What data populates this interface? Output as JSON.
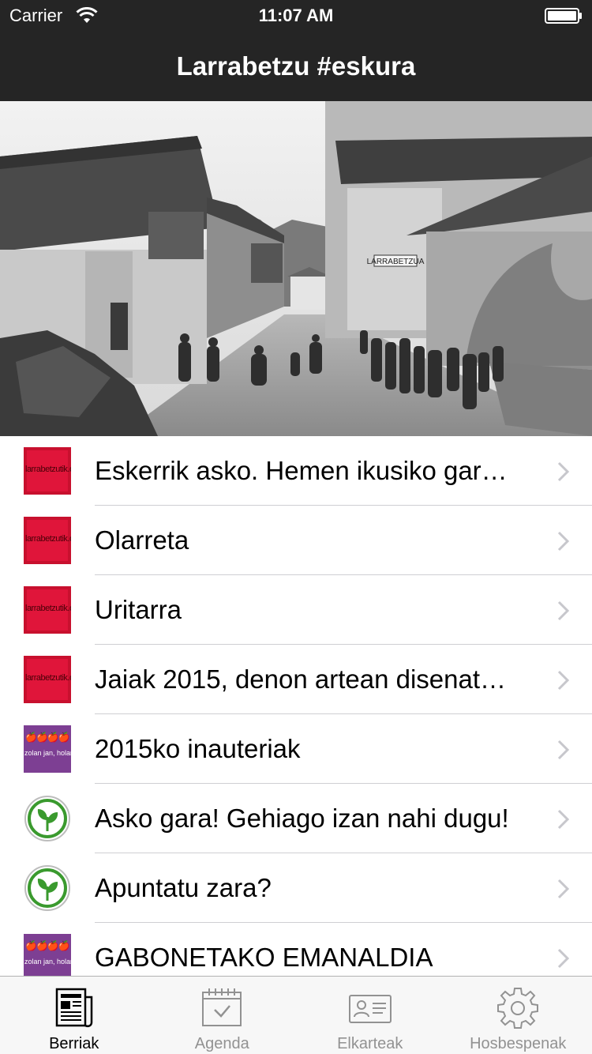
{
  "status_bar": {
    "carrier": "Carrier",
    "time": "11:07 AM",
    "wifi_icon": "wifi-icon",
    "battery_icon": "battery-icon"
  },
  "nav": {
    "title": "Larrabetzu #eskura"
  },
  "hero": {
    "sign_text": "LARRABETZUA"
  },
  "news": [
    {
      "title": "Eskerrik asko. Hemen ikusiko gar…",
      "thumb": "larrabetzutik-logo",
      "thumb_text": "larrabetzutik.org"
    },
    {
      "title": "Olarreta",
      "thumb": "larrabetzutik-logo",
      "thumb_text": "larrabetzutik.org"
    },
    {
      "title": "Uritarra",
      "thumb": "larrabetzutik-logo",
      "thumb_text": "larrabetzutik.org"
    },
    {
      "title": "Jaiak 2015, denon artean disenat…",
      "thumb": "larrabetzutik-logo",
      "thumb_text": "larrabetzutik.org"
    },
    {
      "title": "2015ko inauteriak",
      "thumb": "zolan-jan-logo",
      "thumb_text": "zolan jan, holan izan"
    },
    {
      "title": "Asko gara! Gehiago izan nahi dugu!",
      "thumb": "sprout-logo"
    },
    {
      "title": "Apuntatu zara?",
      "thumb": "sprout-logo"
    },
    {
      "title": "GABONETAKO EMANALDIA",
      "thumb": "zolan-jan-logo",
      "thumb_text": "zolan jan, holan izan"
    }
  ],
  "tabs": [
    {
      "label": "Berriak",
      "icon": "newspaper-icon",
      "active": true
    },
    {
      "label": "Agenda",
      "icon": "calendar-icon",
      "active": false
    },
    {
      "label": "Elkarteak",
      "icon": "contact-card-icon",
      "active": false
    },
    {
      "label": "Hosbespenak",
      "icon": "gear-icon",
      "active": false
    }
  ],
  "colors": {
    "bar_background": "#252525",
    "tab_active": "#000000",
    "tab_inactive": "#929292",
    "separator": "#cfcfd3"
  }
}
